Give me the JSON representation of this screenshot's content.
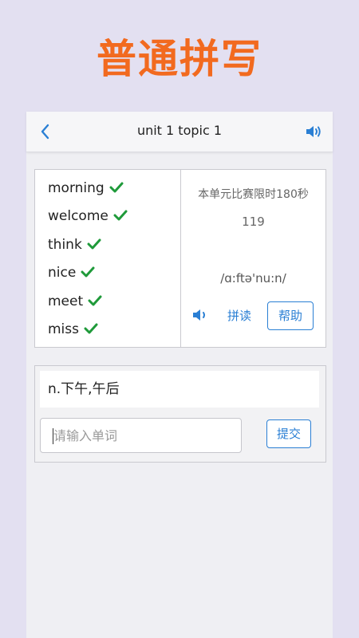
{
  "promo": {
    "title": "普通拼写"
  },
  "header": {
    "title": "unit 1 topic 1",
    "back_icon": "chevron-left-icon",
    "sound_icon": "speaker-icon"
  },
  "words": [
    {
      "text": "morning",
      "done": true
    },
    {
      "text": "welcome",
      "done": true
    },
    {
      "text": "think",
      "done": true
    },
    {
      "text": "nice",
      "done": true
    },
    {
      "text": "meet",
      "done": true
    },
    {
      "text": "miss",
      "done": true
    }
  ],
  "info": {
    "time_limit": "本单元比赛限时180秒",
    "countdown": "119",
    "phonetic": "/ɑ:ftə'nu:n/",
    "spell_label": "拼读",
    "help_label": "帮助"
  },
  "answer": {
    "meaning": "n.下午,午后",
    "input_placeholder": "请输入单词",
    "input_value": "",
    "submit_label": "提交"
  },
  "colors": {
    "accent": "#2a7fd4",
    "promo": "#f26a1f",
    "check": "#1f9a3a",
    "background": "#e3e0f1"
  }
}
